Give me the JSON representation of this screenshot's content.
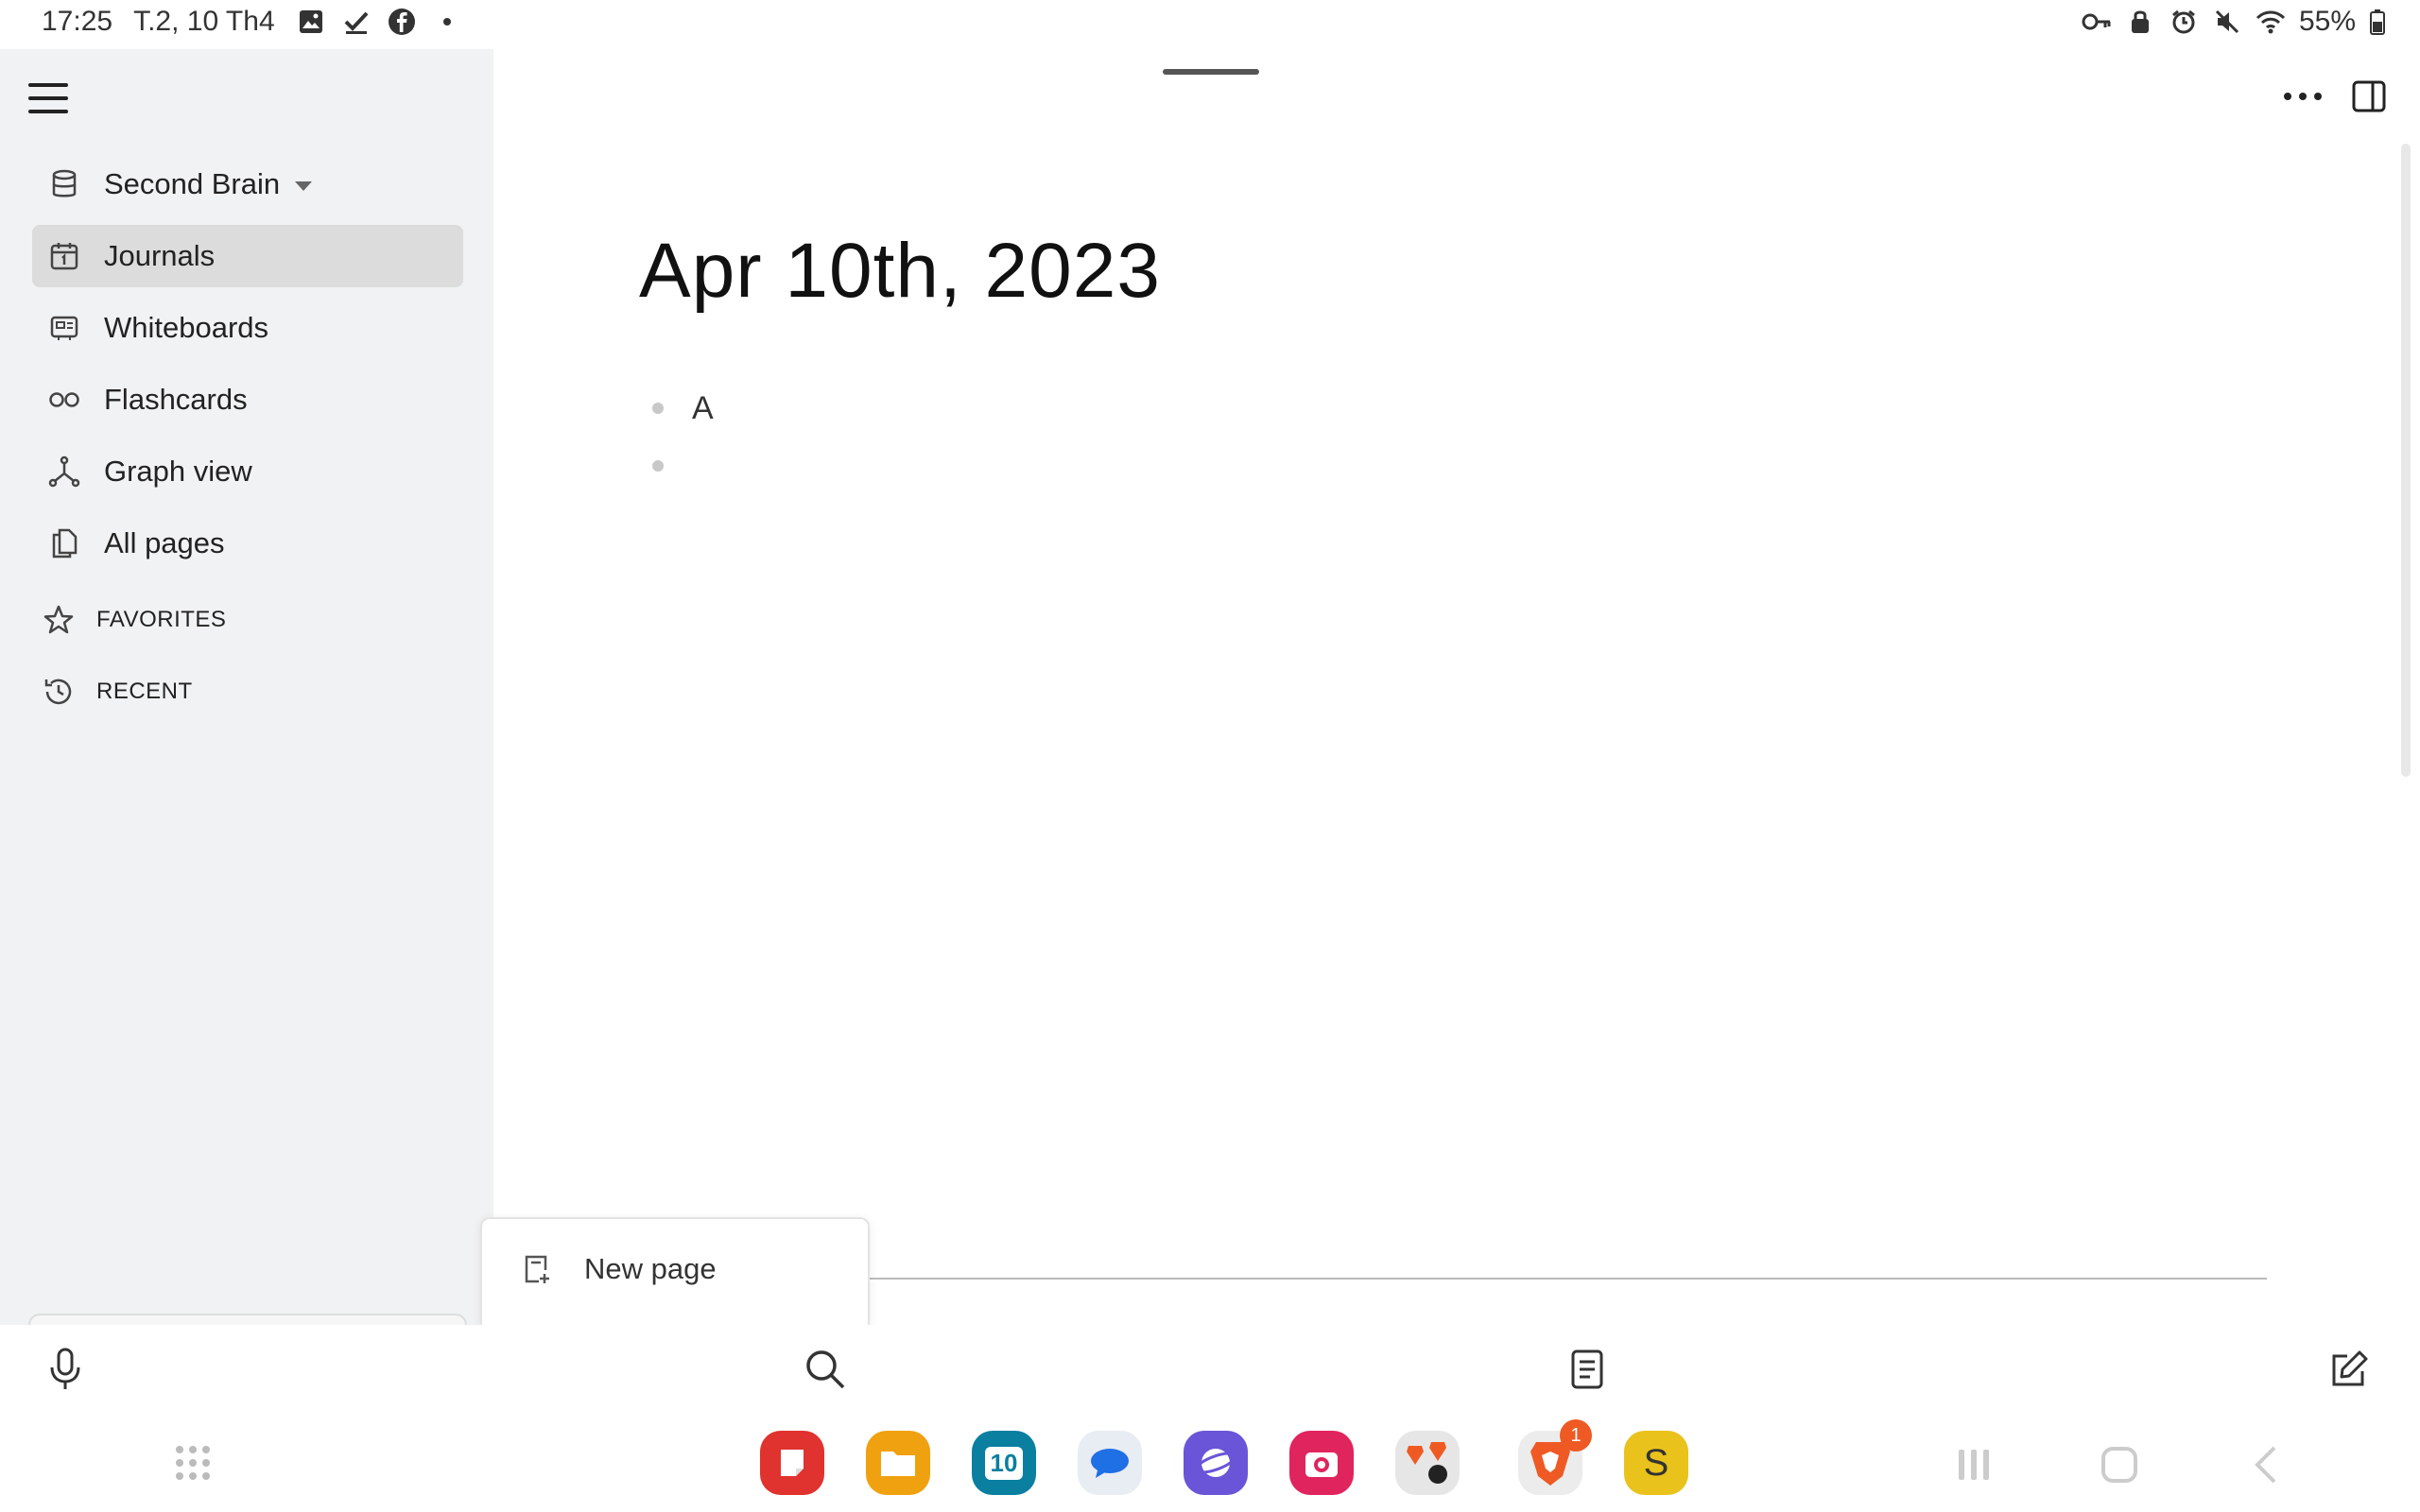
{
  "status_bar": {
    "time": "17:25",
    "date": "T.2, 10 Th4",
    "battery": "55%",
    "left_icons": [
      "gallery-icon",
      "check-icon",
      "facebook-icon",
      "dot-icon"
    ],
    "right_icons": [
      "key-icon",
      "lock-icon",
      "alarm-icon",
      "mute-icon",
      "wifi-icon",
      "battery-icon"
    ]
  },
  "sidebar": {
    "graph_name": "Second Brain",
    "items": [
      {
        "label": "Journals",
        "icon": "calendar-icon",
        "active": true
      },
      {
        "label": "Whiteboards",
        "icon": "whiteboard-icon"
      },
      {
        "label": "Flashcards",
        "icon": "infinity-icon"
      },
      {
        "label": "Graph view",
        "icon": "graph-icon"
      },
      {
        "label": "All pages",
        "icon": "pages-icon"
      }
    ],
    "sections": [
      {
        "label": "FAVORITES",
        "icon": "star-icon"
      },
      {
        "label": "RECENT",
        "icon": "history-icon"
      }
    ]
  },
  "page": {
    "title": "Apr 10th, 2023",
    "blocks": [
      "A",
      ""
    ]
  },
  "popup_menu": {
    "items": [
      {
        "label": "New page",
        "icon": "new-page-icon"
      }
    ]
  },
  "toolbar": {
    "buttons": [
      "microphone-icon",
      "search-icon",
      "document-icon",
      "edit-icon"
    ]
  },
  "taskbar": {
    "apps": [
      {
        "name": "notes-app",
        "color": "#e0322f"
      },
      {
        "name": "files-app",
        "color": "#f0a10f"
      },
      {
        "name": "calendar-app",
        "color": "#0a7fa0",
        "label": "10"
      },
      {
        "name": "messages-app",
        "color": "#e8ecf3"
      },
      {
        "name": "internet-app",
        "color": "#6a55d8"
      },
      {
        "name": "camera-app",
        "color": "#e0245e"
      },
      {
        "name": "brave-folder-app",
        "color": "#e6e6e6"
      },
      {
        "name": "brave-app",
        "color": "#ececec",
        "badge": "1"
      },
      {
        "name": "s-app",
        "color": "#e9c21c",
        "label": "S"
      }
    ],
    "accent": "#ef5a24"
  }
}
